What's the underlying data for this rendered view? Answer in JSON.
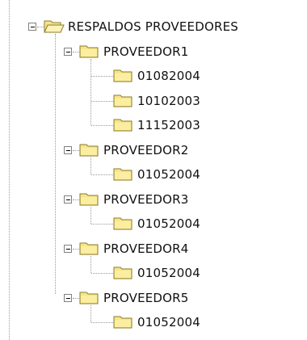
{
  "tree": {
    "root": {
      "label": "RESPALDOS PROVEEDORES",
      "expanded": true,
      "icon": "folder-open-icon"
    },
    "providers": [
      {
        "label": "PROVEEDOR1",
        "expanded": true,
        "icon": "folder-icon",
        "children": [
          {
            "label": "01082004"
          },
          {
            "label": "10102003"
          },
          {
            "label": "11152003"
          }
        ]
      },
      {
        "label": "PROVEEDOR2",
        "expanded": true,
        "icon": "folder-icon",
        "children": [
          {
            "label": "01052004"
          }
        ]
      },
      {
        "label": "PROVEEDOR3",
        "expanded": true,
        "icon": "folder-icon",
        "children": [
          {
            "label": "01052004"
          }
        ]
      },
      {
        "label": "PROVEEDOR4",
        "expanded": true,
        "icon": "folder-icon",
        "children": [
          {
            "label": "01052004"
          }
        ]
      },
      {
        "label": "PROVEEDOR5",
        "expanded": true,
        "icon": "folder-icon",
        "children": [
          {
            "label": "01052004"
          }
        ]
      }
    ]
  },
  "colors": {
    "folder_fill": "#f7e58a",
    "folder_stroke": "#8a7a2a",
    "line": "#9a9a9a"
  }
}
